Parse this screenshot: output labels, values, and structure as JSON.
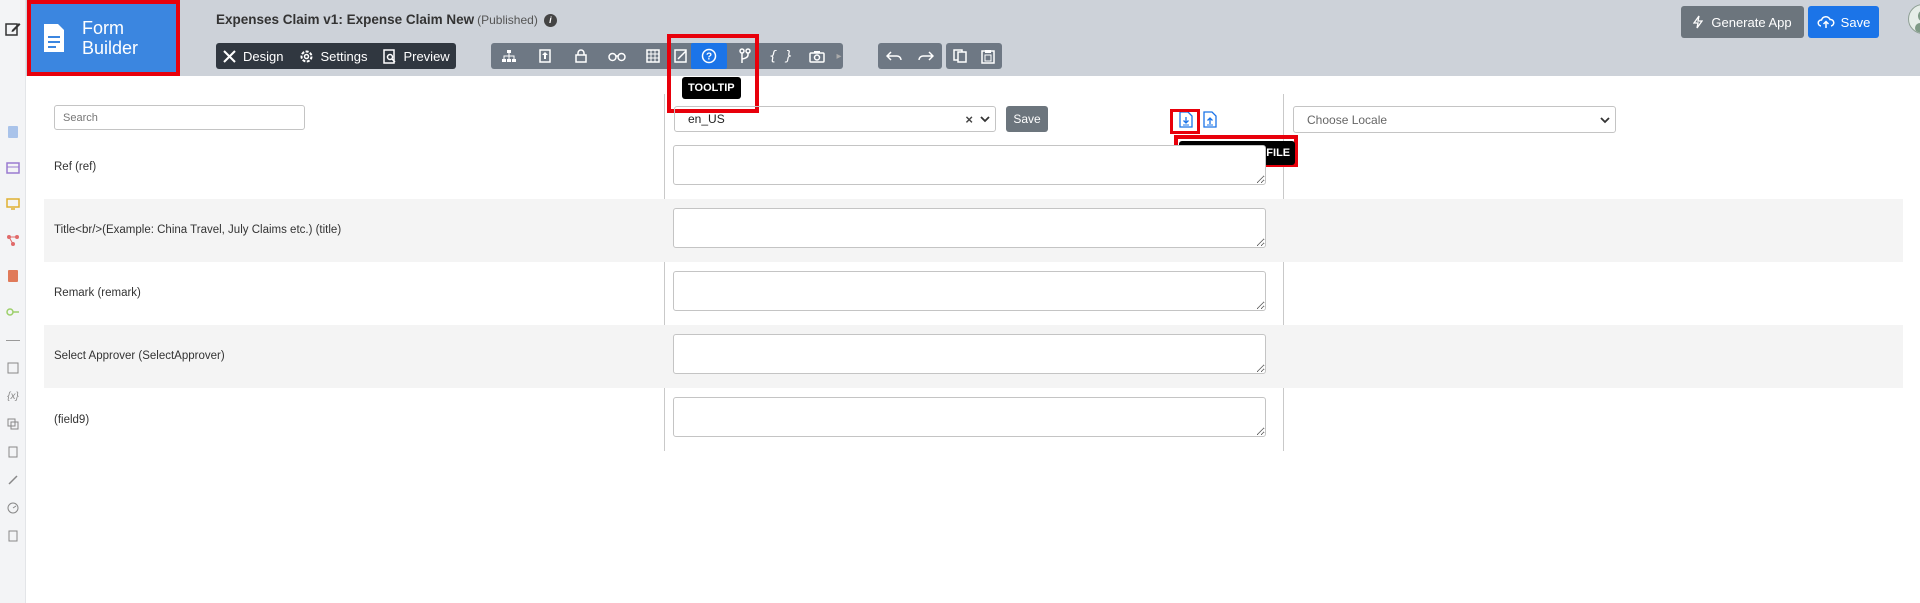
{
  "brand": {
    "title_line1": "Form",
    "title_line2": "Builder"
  },
  "header": {
    "form_title": "Expenses Claim v1: Expense Claim New",
    "form_status": "(Published)",
    "tabs": [
      {
        "label": "Design",
        "icon": "design-tools-icon"
      },
      {
        "label": "Settings",
        "icon": "gear-icon"
      },
      {
        "label": "Preview",
        "icon": "preview-icon"
      }
    ],
    "toolbar_icons": [
      "tree-icon",
      "properties-icon",
      "lock-icon",
      "binoculars-icon",
      "grid-icon",
      "edit-icon",
      "tooltip-icon",
      "branch-icon",
      "braces-icon",
      "camera-icon"
    ],
    "undo_redo": [
      "undo-icon",
      "redo-icon"
    ],
    "clipboard": [
      "copy-icon",
      "paste-icon"
    ],
    "tooltip_text": "TOOLTIP",
    "generate_app_label": "Generate App",
    "save_label": "Save"
  },
  "content": {
    "search_placeholder": "Search",
    "locale_value": "en_US",
    "locale_clear": "×",
    "locale_save_label": "Save",
    "po_tooltip": "GENERATE PO FILE",
    "choose_locale_placeholder": "Choose Locale",
    "rows": [
      {
        "label": "Ref (ref)"
      },
      {
        "label": "Title<br/>(Example: China Travel, July Claims etc.) (title)"
      },
      {
        "label": "Remark (remark)"
      },
      {
        "label": "Select Approver (SelectApprover)"
      },
      {
        "label": "(field9)"
      }
    ]
  },
  "colors": {
    "brand_blue": "#3b86e0",
    "primary_blue": "#1b74e8",
    "highlight_red": "#e8000b",
    "header_bg": "#cdd2d9"
  }
}
